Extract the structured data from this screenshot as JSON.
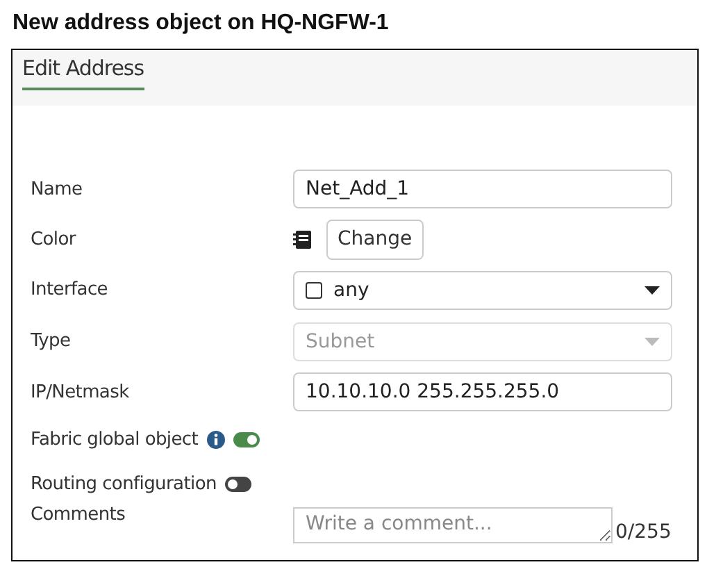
{
  "page_title": "New address object on HQ-NGFW-1",
  "dialog": {
    "title": "Edit Address",
    "fields": [
      {
        "kind": "text",
        "label": "Name",
        "value": "Net_Add_1"
      },
      {
        "kind": "color",
        "label": "Color",
        "button": "Change"
      },
      {
        "kind": "select",
        "label": "Interface",
        "value": "any",
        "disabled": false,
        "checkbox": true
      },
      {
        "kind": "select",
        "label": "Type",
        "value": "Subnet",
        "disabled": true,
        "checkbox": false
      },
      {
        "kind": "text",
        "label": "IP/Netmask",
        "value": "10.10.10.0 255.255.255.0"
      },
      {
        "kind": "toggle",
        "label": "Fabric global object",
        "on": true,
        "info": true
      },
      {
        "kind": "toggle",
        "label": "Routing configuration",
        "on": false,
        "info": false
      },
      {
        "kind": "textarea",
        "label": "Comments",
        "placeholder": "Write a comment...",
        "counter": "0/255"
      }
    ]
  }
}
